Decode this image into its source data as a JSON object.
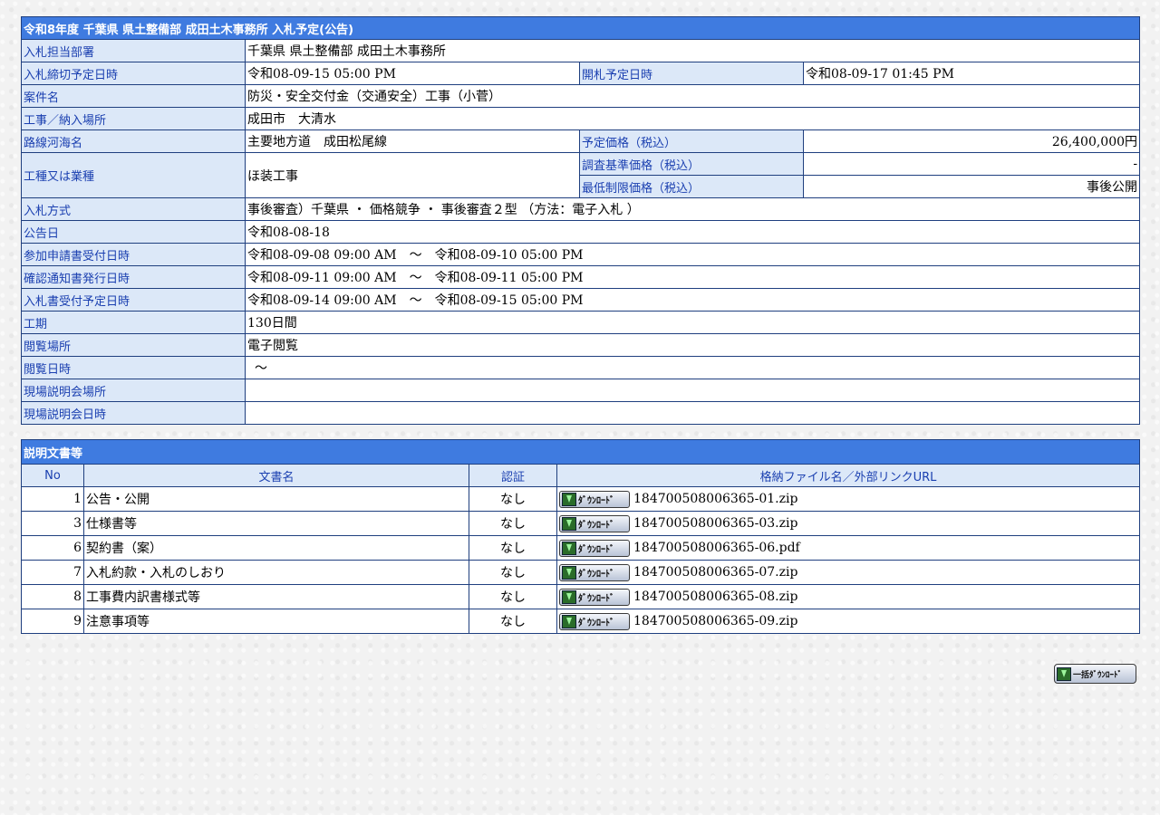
{
  "info": {
    "title": "令和8年度 千葉県 県土整備部 成田土木事務所 入札予定(公告)",
    "rows": {
      "dept": {
        "label": "入札担当部署",
        "value": "千葉県 県土整備部 成田土木事務所"
      },
      "deadline": {
        "label": "入札締切予定日時",
        "value": "令和08-09-15 05:00 PM"
      },
      "opening": {
        "label": "開札予定日時",
        "value": "令和08-09-17 01:45 PM"
      },
      "case_name": {
        "label": "案件名",
        "value": "防災・安全交付金（交通安全）工事（小菅）"
      },
      "location": {
        "label": "工事／納入場所",
        "value": "成田市　大清水"
      },
      "route": {
        "label": "路線河海名",
        "value": "主要地方道　成田松尾線"
      },
      "planned_price": {
        "label": "予定価格（税込）",
        "value": "26,400,000円"
      },
      "work_type": {
        "label": "工種又は業種",
        "value": "ほ装工事"
      },
      "survey_price": {
        "label": "調査基準価格（税込）",
        "value": "-"
      },
      "min_price": {
        "label": "最低制限価格（税込）",
        "value": "事後公開"
      },
      "method": {
        "label": "入札方式",
        "value": "事後審査）千葉県 ・ 価格競争 ・ 事後審査２型 （方法：電子入札 ）"
      },
      "notice_date": {
        "label": "公告日",
        "value": "令和08-08-18"
      },
      "app_accept": {
        "label": "参加申請書受付日時",
        "value": "令和08-09-08 09:00 AM　～　令和08-09-10 05:00 PM"
      },
      "confirm_issue": {
        "label": "確認通知書発行日時",
        "value": "令和08-09-11 09:00 AM　～　令和08-09-11 05:00 PM"
      },
      "bid_accept": {
        "label": "入札書受付予定日時",
        "value": "令和08-09-14 09:00 AM　～　令和08-09-15 05:00 PM"
      },
      "period": {
        "label": "工期",
        "value": "130日間"
      },
      "view_place": {
        "label": "閲覧場所",
        "value": "電子閲覧"
      },
      "view_date": {
        "label": "閲覧日時",
        "value": "～"
      },
      "site_place": {
        "label": "現場説明会場所",
        "value": ""
      },
      "site_date": {
        "label": "現場説明会日時",
        "value": ""
      }
    }
  },
  "docs": {
    "title": "説明文書等",
    "headers": {
      "no": "No",
      "name": "文書名",
      "cert": "認証",
      "file": "格納ファイル名／外部リンクURL"
    },
    "download_label": "ﾀﾞｳﾝﾛｰﾄﾞ",
    "items": [
      {
        "no": "1",
        "name": "公告・公開",
        "cert": "なし",
        "file": "184700508006365-01.zip"
      },
      {
        "no": "3",
        "name": "仕様書等",
        "cert": "なし",
        "file": "184700508006365-03.zip"
      },
      {
        "no": "6",
        "name": "契約書（案）",
        "cert": "なし",
        "file": "184700508006365-06.pdf"
      },
      {
        "no": "7",
        "name": "入札約款・入札のしおり",
        "cert": "なし",
        "file": "184700508006365-07.zip"
      },
      {
        "no": "8",
        "name": "工事費内訳書様式等",
        "cert": "なし",
        "file": "184700508006365-08.zip"
      },
      {
        "no": "9",
        "name": "注意事項等",
        "cert": "なし",
        "file": "184700508006365-09.zip"
      }
    ],
    "bulk_label": "一括ﾀﾞｳﾝﾛｰﾄﾞ"
  }
}
